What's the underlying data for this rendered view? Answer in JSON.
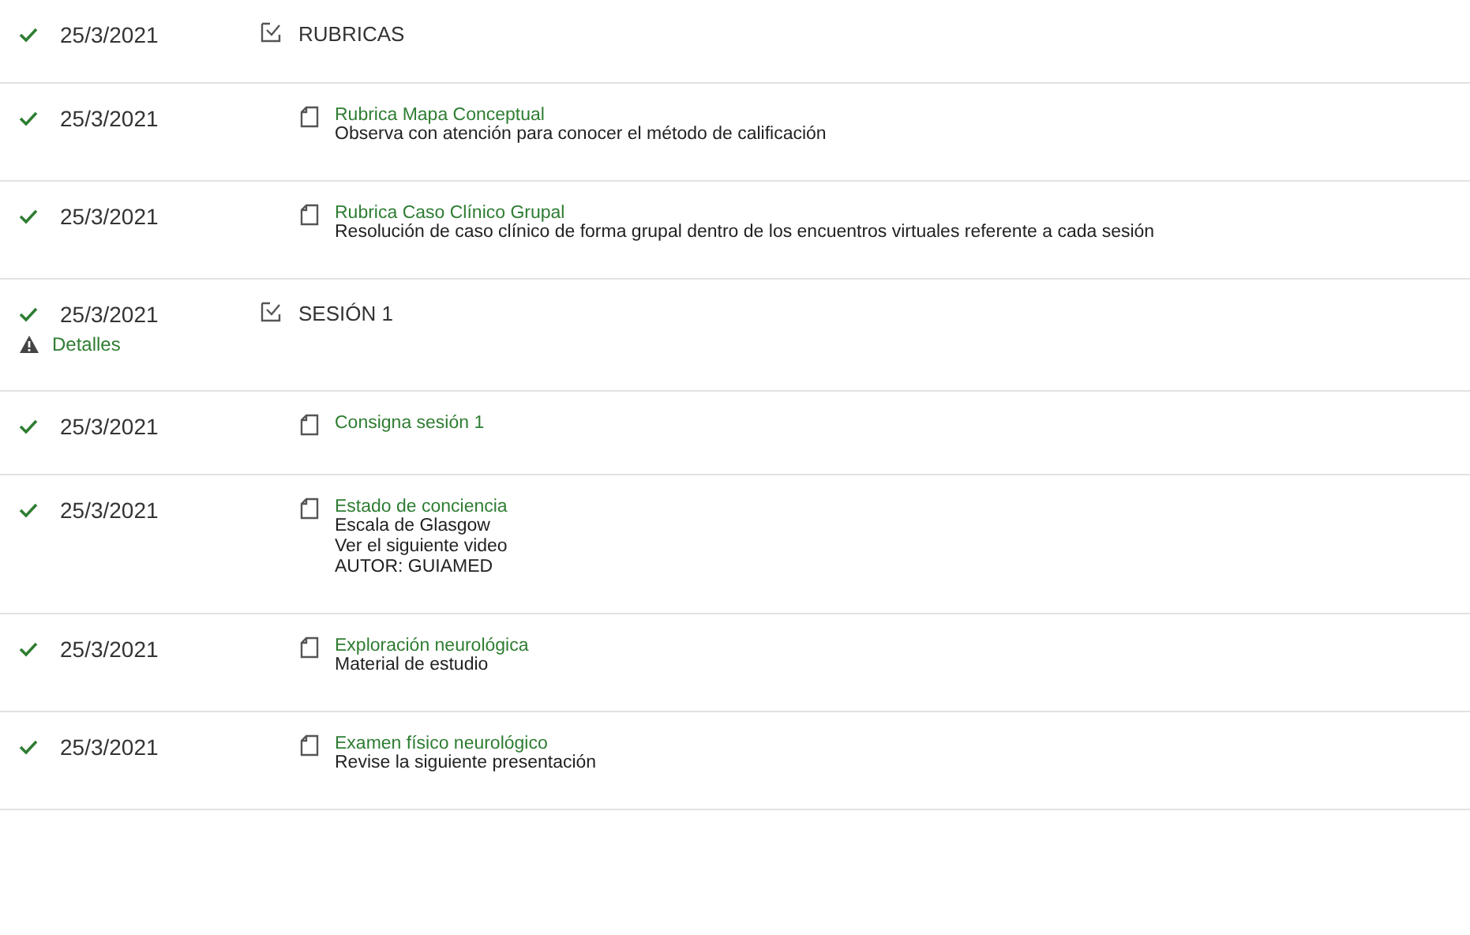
{
  "rows": [
    {
      "kind": "section",
      "done": true,
      "date": "25/3/2021",
      "title": "RUBRICAS"
    },
    {
      "kind": "item",
      "done": true,
      "date": "25/3/2021",
      "title": "Rubrica Mapa Conceptual",
      "lines": [
        "Observa con atención para conocer el método de calificación"
      ]
    },
    {
      "kind": "item",
      "done": true,
      "date": "25/3/2021",
      "title": "Rubrica Caso Clínico Grupal",
      "lines": [
        "Resolución de caso clínico de forma grupal dentro de los encuentros virtuales referente a cada sesión"
      ]
    },
    {
      "kind": "section",
      "done": true,
      "date": "25/3/2021",
      "title": "SESIÓN 1",
      "details": "Detalles"
    },
    {
      "kind": "item",
      "done": true,
      "date": "25/3/2021",
      "title": "Consigna sesión 1"
    },
    {
      "kind": "item",
      "done": true,
      "date": "25/3/2021",
      "title": "Estado de conciencia",
      "lines": [
        "Escala de Glasgow",
        "Ver el siguiente video",
        "AUTOR: GUIAMED"
      ]
    },
    {
      "kind": "item",
      "done": true,
      "date": "25/3/2021",
      "title": "Exploración neurológica",
      "lines": [
        "Material de estudio"
      ]
    },
    {
      "kind": "item",
      "done": true,
      "date": "25/3/2021",
      "title": "Examen físico neurológico",
      "lines": [
        "Revise la siguiente presentación"
      ]
    }
  ]
}
